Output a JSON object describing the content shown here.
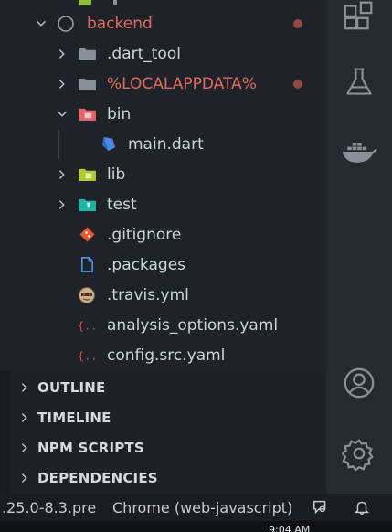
{
  "explorer": {
    "items": [
      {
        "label": "backend",
        "expanded": true,
        "modified": true,
        "icon": "folder-circle-icon"
      },
      {
        "label": ".dart_tool",
        "expanded": false,
        "modified": false,
        "icon": "folder-icon"
      },
      {
        "label": "%LOCALAPPDATA%",
        "expanded": false,
        "modified": true,
        "icon": "folder-icon"
      },
      {
        "label": "bin",
        "expanded": true,
        "modified": false,
        "icon": "folder-bin-icon"
      },
      {
        "label": "main.dart",
        "icon": "dart-file-icon"
      },
      {
        "label": "lib",
        "expanded": false,
        "icon": "folder-lib-icon"
      },
      {
        "label": "test",
        "expanded": false,
        "icon": "folder-test-icon"
      },
      {
        "label": ".gitignore",
        "icon": "git-icon"
      },
      {
        "label": ".packages",
        "icon": "file-icon"
      },
      {
        "label": ".travis.yml",
        "icon": "travis-icon"
      },
      {
        "label": "analysis_options.yaml",
        "icon": "yaml-icon"
      },
      {
        "label": "config.src.yaml",
        "icon": "yaml-icon"
      }
    ]
  },
  "panels": [
    {
      "label": "OUTLINE"
    },
    {
      "label": "TIMELINE"
    },
    {
      "label": "NPM SCRIPTS"
    },
    {
      "label": "DEPENDENCIES"
    }
  ],
  "activity_bar": [
    "extensions-icon",
    "testing-icon",
    "docker-icon",
    "account-icon",
    "settings-gear-icon"
  ],
  "statusbar": {
    "version": ".25.0-8.3.pre",
    "device": "Chrome (web-javascript)"
  },
  "taskbar": {
    "clock": "9:04 AM"
  },
  "colors": {
    "modified_text": "#e06c5f",
    "modified_dot": "#8e4a47",
    "sidebar_bg": "#1f2329",
    "activity_bg": "#252a31"
  }
}
